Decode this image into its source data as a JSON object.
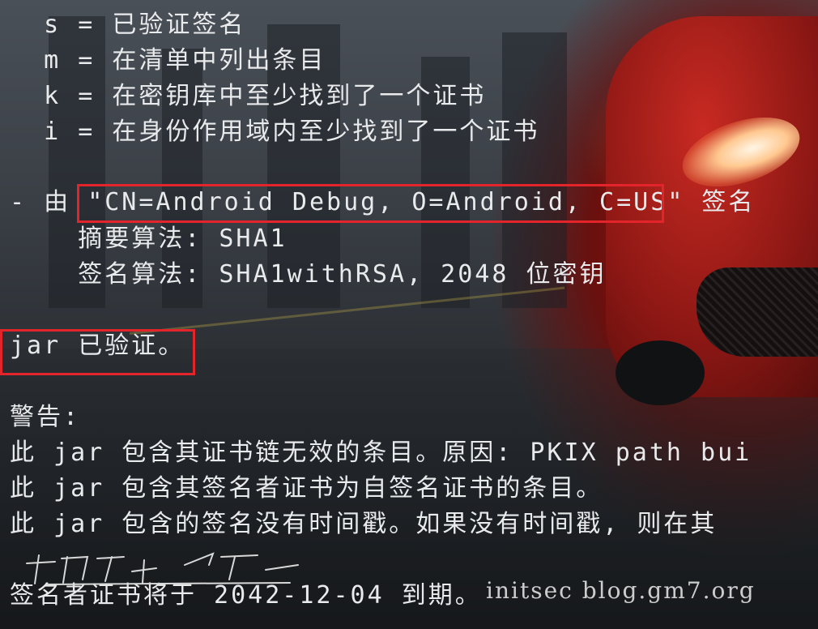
{
  "terminal": {
    "legend": [
      "  s = 已验证签名",
      "  m = 在清单中列出条目",
      "  k = 在密钥库中至少找到了一个证书",
      "  i = 在身份作用域内至少找到了一个证书"
    ],
    "signer": {
      "prefix": "- 由 ",
      "dn": "\"CN=Android Debug, O=Android, C=US\"",
      "suffix": " 签名"
    },
    "digest_line": "    摘要算法: SHA1",
    "sig_line": "    签名算法: SHA1withRSA, 2048 位密钥",
    "verified": "jar 已验证。",
    "warning_title": "警告:",
    "warnings": [
      "此 jar 包含其证书链无效的条目。原因: PKIX path bui",
      "此 jar 包含其签名者证书为自签名证书的条目。",
      "此 jar 包含的签名没有时间戳。如果没有时间戳, 则在其"
    ],
    "expiry": "签名者证书将于 2042-12-04 到期。"
  },
  "watermark": "initsec blog.gm7.org",
  "colors": {
    "highlight_box": "#e3242b",
    "terminal_text": "#e9eaec",
    "car_red": "#c82a22"
  }
}
